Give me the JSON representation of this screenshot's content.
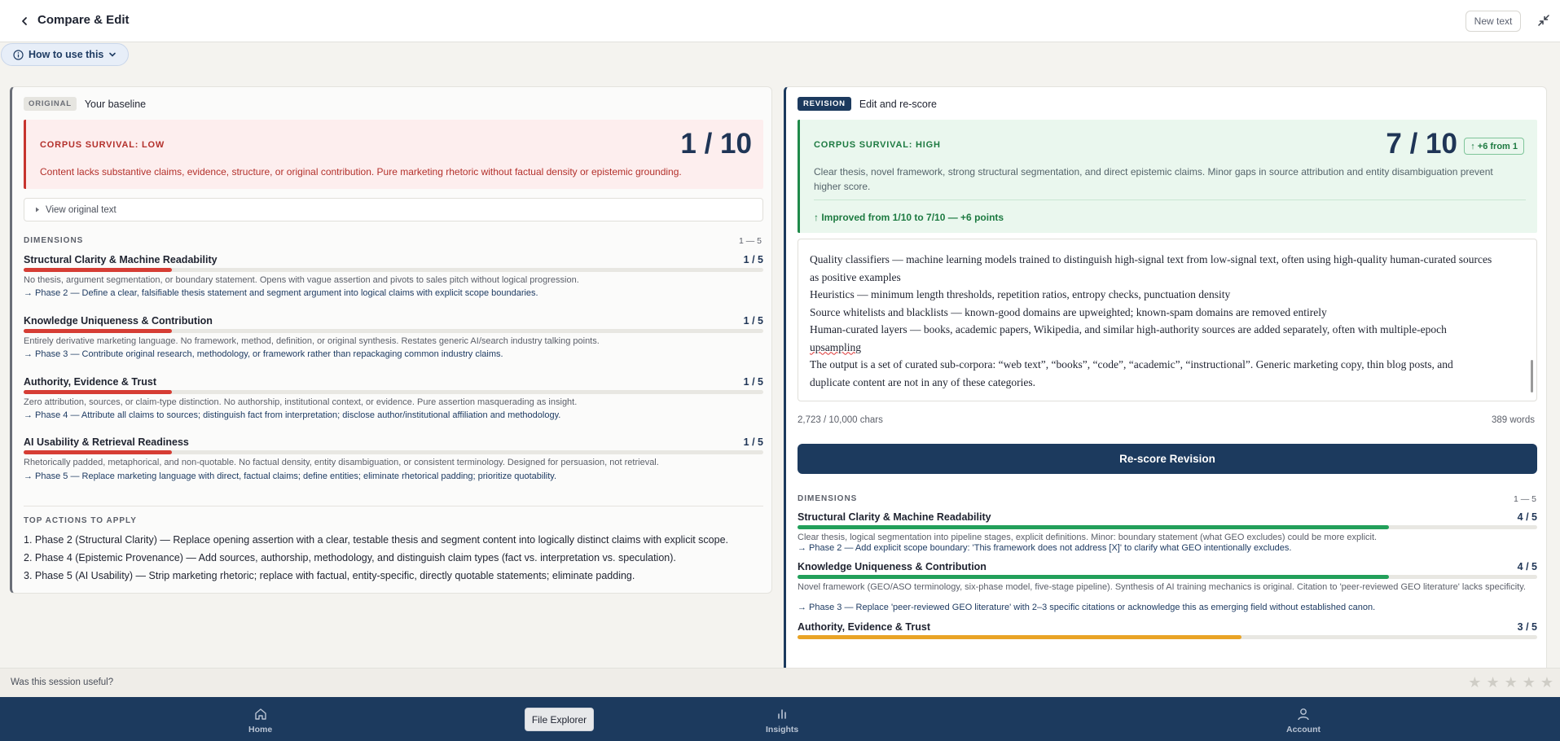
{
  "header": {
    "title": "Compare & Edit",
    "new_text_label": "New text",
    "back_icon": "chevron-left-icon",
    "collapse_icon": "collapse-icon"
  },
  "howto": {
    "label": "How to use this"
  },
  "original": {
    "tag": "ORIGINAL",
    "title": "Your baseline",
    "survival_label": "CORPUS SURVIVAL: LOW",
    "score": "1 / 10",
    "description": "Content lacks substantive claims, evidence, structure, or original contribution. Pure marketing rhetoric without factual density or epistemic grounding.",
    "view_original": "View original text",
    "dims_heading": "DIMENSIONS",
    "dims_range": "1 — 5",
    "dimensions": [
      {
        "name": "Structural Clarity & Machine Readability",
        "score": "1 / 5",
        "level": 0.2,
        "desc": "No thesis, argument segmentation, or boundary statement. Opens with vague assertion and pivots to sales pitch without logical progression.",
        "action": "→ Phase 2 — Define a clear, falsifiable thesis statement and segment argument into logical claims with explicit scope boundaries."
      },
      {
        "name": "Knowledge Uniqueness & Contribution",
        "score": "1 / 5",
        "level": 0.2,
        "desc": "Entirely derivative marketing language. No framework, method, definition, or original synthesis. Restates generic AI/search industry talking points.",
        "action": "→ Phase 3 — Contribute original research, methodology, or framework rather than repackaging common industry claims."
      },
      {
        "name": "Authority, Evidence & Trust",
        "score": "1 / 5",
        "level": 0.2,
        "desc": "Zero attribution, sources, or claim-type distinction. No authorship, institutional context, or evidence. Pure assertion masquerading as insight.",
        "action": "→ Phase 4 — Attribute all claims to sources; distinguish fact from interpretation; disclose author/institutional affiliation and methodology."
      },
      {
        "name": "AI Usability & Retrieval Readiness",
        "score": "1 / 5",
        "level": 0.2,
        "desc": "Rhetorically padded, metaphorical, and non-quotable. No factual density, entity disambiguation, or consistent terminology. Designed for persuasion, not retrieval.",
        "action": "→ Phase 5 — Replace marketing language with direct, factual claims; define entities; eliminate rhetorical padding; prioritize quotability."
      }
    ],
    "top_actions_heading": "TOP ACTIONS TO APPLY",
    "top_actions": [
      "1. Phase 2 (Structural Clarity) — Replace opening assertion with a clear, testable thesis and segment content into logically distinct claims with explicit scope.",
      "2. Phase 4 (Epistemic Provenance) — Add sources, authorship, methodology, and distinguish claim types (fact vs. interpretation vs. speculation).",
      "3. Phase 5 (AI Usability) — Strip marketing rhetoric; replace with factual, entity-specific, directly quotable statements; eliminate padding."
    ]
  },
  "revision": {
    "tag": "REVISION",
    "title": "Edit and re-score",
    "survival_label": "CORPUS SURVIVAL: HIGH",
    "score": "7 / 10",
    "delta": "↑ +6 from 1",
    "description": "Clear thesis, novel framework, strong structural segmentation, and direct epistemic claims. Minor gaps in source attribution and entity disambiguation prevent higher score.",
    "improvement": "↑ Improved from 1/10 to 7/10 — +6 points",
    "text_lines": [
      "Quality classifiers — machine learning models trained to distinguish high-signal text from low-signal text, often using high-quality human-curated sources as positive examples",
      "Heuristics — minimum length thresholds, repetition ratios, entropy checks, punctuation density",
      "Source whitelists and blacklists — known-good domains are upweighted; known-spam domains are removed entirely",
      "Human-curated layers — books, academic papers, Wikipedia, and similar high-authority sources are added separately, often with multiple-epoch",
      "upsampling",
      "The output is a set of curated sub-corpora: “web text”, “books”, “code”, “academic”, “instructional”. Generic marketing copy, thin blog posts, and duplicate content are not in any of these categories."
    ],
    "char_count": "2,723 / 10,000 chars",
    "word_count": "389 words",
    "rescore_label": "Re-score Revision",
    "dims_heading": "DIMENSIONS",
    "dims_range": "1 — 5",
    "dimensions": [
      {
        "name": "Structural Clarity & Machine Readability",
        "score": "4 / 5",
        "level": 0.8,
        "desc": "Clear thesis, logical segmentation into pipeline stages, explicit definitions. Minor: boundary statement (what GEO excludes) could be more explicit.",
        "action": "→ Phase 2 — Add explicit scope boundary: 'This framework does not address [X]' to clarify what GEO intentionally excludes."
      },
      {
        "name": "Knowledge Uniqueness & Contribution",
        "score": "4 / 5",
        "level": 0.8,
        "desc": "Novel framework (GEO/ASO terminology, six-phase model, five-stage pipeline). Synthesis of AI training mechanics is original. Citation to 'peer-reviewed GEO literature' lacks specificity.",
        "action": "→ Phase 3 — Replace 'peer-reviewed GEO literature' with 2–3 specific citations or acknowledge this as emerging field without established canon."
      },
      {
        "name": "Authority, Evidence & Trust",
        "score": "3 / 5",
        "level": 0.6,
        "desc": "",
        "action": ""
      }
    ]
  },
  "session": {
    "question": "Was this session useful?",
    "stars": [
      "★",
      "★",
      "★",
      "★",
      "★"
    ]
  },
  "nav": {
    "home": "Home",
    "file_explorer": "File Explorer",
    "insights": "Insights",
    "account": "Account"
  },
  "colors": {
    "low_fill": "#d63d34",
    "high_fill": "#22a05a",
    "mid_fill": "#e9a426",
    "navy": "#1c3a5e"
  }
}
